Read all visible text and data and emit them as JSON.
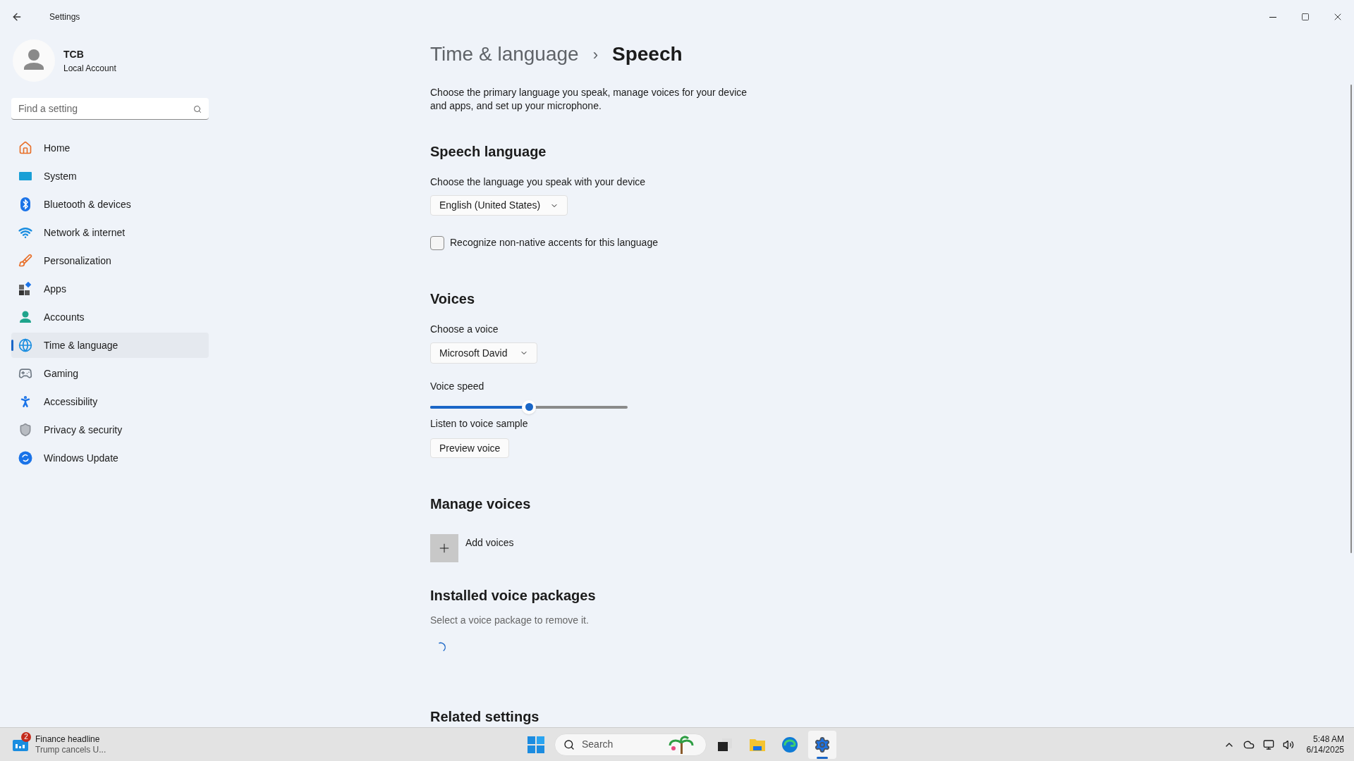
{
  "window": {
    "title": "Settings"
  },
  "profile": {
    "name": "TCB",
    "account_type": "Local Account"
  },
  "sidebar": {
    "search": {
      "placeholder": "Find a setting"
    },
    "items": [
      {
        "label": "Home",
        "kind": "home",
        "selected": false
      },
      {
        "label": "System",
        "kind": "system",
        "selected": false
      },
      {
        "label": "Bluetooth & devices",
        "kind": "bluetooth",
        "selected": false
      },
      {
        "label": "Network & internet",
        "kind": "network",
        "selected": false
      },
      {
        "label": "Personalization",
        "kind": "personalization",
        "selected": false
      },
      {
        "label": "Apps",
        "kind": "apps",
        "selected": false
      },
      {
        "label": "Accounts",
        "kind": "accounts",
        "selected": false
      },
      {
        "label": "Time & language",
        "kind": "time",
        "selected": true
      },
      {
        "label": "Gaming",
        "kind": "gaming",
        "selected": false
      },
      {
        "label": "Accessibility",
        "kind": "accessibility",
        "selected": false
      },
      {
        "label": "Privacy & security",
        "kind": "privacy",
        "selected": false
      },
      {
        "label": "Windows Update",
        "kind": "update",
        "selected": false
      }
    ]
  },
  "breadcrumb": {
    "parent": "Time & language",
    "separator": "›",
    "current": "Speech"
  },
  "description": "Choose the primary language you speak, manage voices for your device and apps, and set up your microphone.",
  "speech_language": {
    "heading": "Speech language",
    "label": "Choose the language you speak with your device",
    "dropdown": "English (United States)",
    "checkbox": {
      "label": "Recognize non-native accents for this language",
      "checked": false
    }
  },
  "voices": {
    "heading": "Voices",
    "label": "Choose a voice",
    "dropdown": "Microsoft David",
    "speed_label": "Voice speed",
    "speed": {
      "level": 0.5
    },
    "sample_label": "Listen to voice sample",
    "preview_button": "Preview voice"
  },
  "manage_voices": {
    "heading": "Manage voices",
    "add_label": "Add voices"
  },
  "installed": {
    "heading": "Installed voice packages",
    "hint": "Select a voice package to remove it."
  },
  "related": {
    "heading": "Related settings"
  },
  "taskbar": {
    "widget": {
      "badge": "2",
      "title": "Finance headline",
      "subtitle": "Trump cancels U..."
    },
    "search": {
      "placeholder": "Search"
    },
    "apps": [
      {
        "kind": "start",
        "selected": false
      },
      {
        "kind": "taskview",
        "selected": false
      },
      {
        "kind": "files",
        "selected": false
      },
      {
        "kind": "edge",
        "selected": false
      },
      {
        "kind": "settings",
        "selected": true
      }
    ],
    "time": "5:48 AM",
    "date": "6/14/2025"
  }
}
